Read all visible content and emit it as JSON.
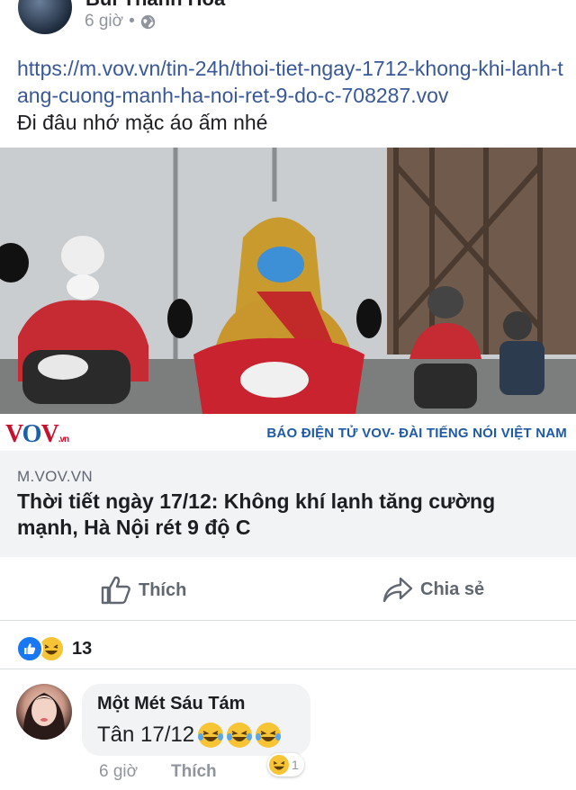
{
  "post": {
    "author": "Bùi Thanh Hoa",
    "time": "6 giờ",
    "dot": "•",
    "link": "https://m.vov.vn/tin-24h/thoi-tiet-ngay-1712-khong-khi-lanh-tang-cuong-manh-ha-noi-ret-9-do-c-708287.vov",
    "text": "Đi đâu nhớ mặc áo ấm nhé"
  },
  "image": {
    "logo_v": "V",
    "logo_o": "O",
    "logo_v2": "V",
    "logo_suffix": ".vn",
    "tagline": "BÁO ĐIỆN TỬ VOV- ĐÀI TIẾNG NÓI VIỆT NAM"
  },
  "preview": {
    "domain": "M.VOV.VN",
    "title": "Thời tiết ngày 17/12: Không khí lạnh tăng cường mạnh, Hà Nội rét 9 độ C"
  },
  "actions": {
    "like": "Thích",
    "share": "Chia sẻ"
  },
  "reactions": {
    "count": "13"
  },
  "comment": {
    "name": "Một Mét Sáu Tám",
    "text": "Tân 17/12",
    "time": "6 giờ",
    "like": "Thích",
    "reaction_count": "1"
  },
  "colors": {
    "link": "#385898",
    "like_blue": "#1877f2",
    "haha_yellow": "#f7c436",
    "vov_red": "#c8102e",
    "vov_blue": "#1f5aa6"
  },
  "icons": [
    "globe-icon",
    "thumbs-up-icon",
    "share-arrow-icon",
    "like-reaction-icon",
    "haha-reaction-icon"
  ]
}
